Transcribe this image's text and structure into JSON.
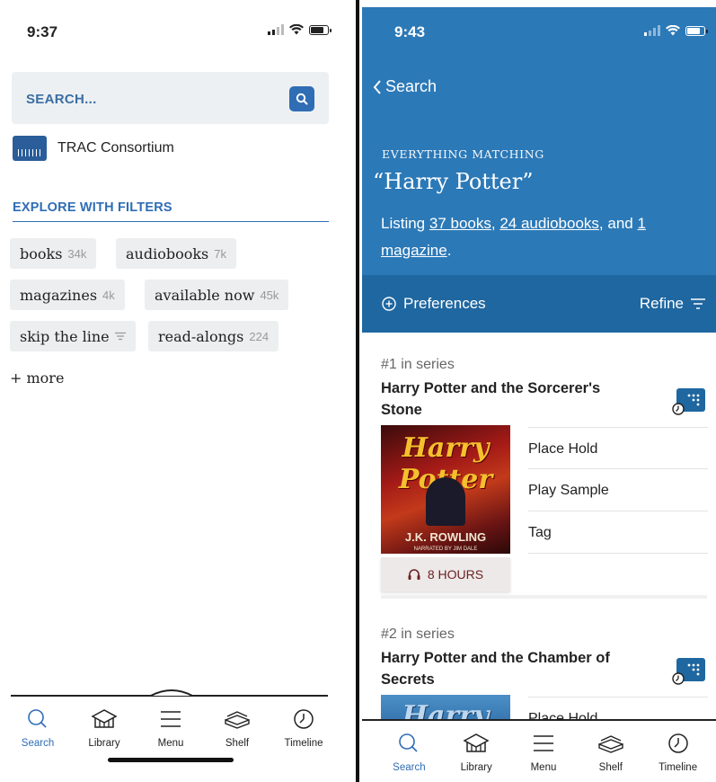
{
  "left": {
    "status": {
      "time": "9:37"
    },
    "search": {
      "placeholder": "SEARCH..."
    },
    "library": {
      "name": "TRAC Consortium"
    },
    "filters": {
      "title": "EXPLORE WITH FILTERS",
      "chips": [
        {
          "label": "books",
          "count": "34k"
        },
        {
          "label": "audiobooks",
          "count": "7k"
        },
        {
          "label": "magazines",
          "count": "4k"
        },
        {
          "label": "available now",
          "count": "45k"
        },
        {
          "label": "skip the line",
          "count": ""
        },
        {
          "label": "read-alongs",
          "count": "224"
        }
      ],
      "more": "+ more"
    }
  },
  "right": {
    "status": {
      "time": "9:43"
    },
    "back_label": "Search",
    "eyebrow": "EVERYTHING MATCHING",
    "query": "“Harry Potter”",
    "listing": {
      "prefix": "Listing ",
      "books": "37 books",
      "sep1": ", ",
      "audiobooks": "24 audiobooks",
      "sep2": ", and ",
      "magazine": "1 magazine",
      "suffix": "."
    },
    "preferences": "Preferences",
    "refine": "Refine",
    "items": [
      {
        "series": "#1 in series",
        "title": "Harry Potter and the Sorcerer's Stone",
        "cover_title": "Harry Potter",
        "cover_author": "J.K. ROWLING",
        "cover_narrator": "NARRATED BY JIM DALE",
        "duration": "8 HOURS",
        "actions": [
          "Place Hold",
          "Play Sample",
          "Tag"
        ]
      },
      {
        "series": "#2 in series",
        "title": "Harry Potter and the Chamber of Secrets",
        "cover_title": "Harry Potter",
        "actions": [
          "Place Hold"
        ]
      }
    ]
  },
  "tabs": [
    {
      "label": "Search",
      "icon": "magnifier-icon",
      "active": true
    },
    {
      "label": "Library",
      "icon": "library-icon"
    },
    {
      "label": "Menu",
      "icon": "menu-icon"
    },
    {
      "label": "Shelf",
      "icon": "shelf-icon"
    },
    {
      "label": "Timeline",
      "icon": "clock-icon"
    }
  ],
  "colors": {
    "accent": "#2f6db5",
    "hero": "#2c79b7",
    "hero_dark": "#1f67a0"
  }
}
